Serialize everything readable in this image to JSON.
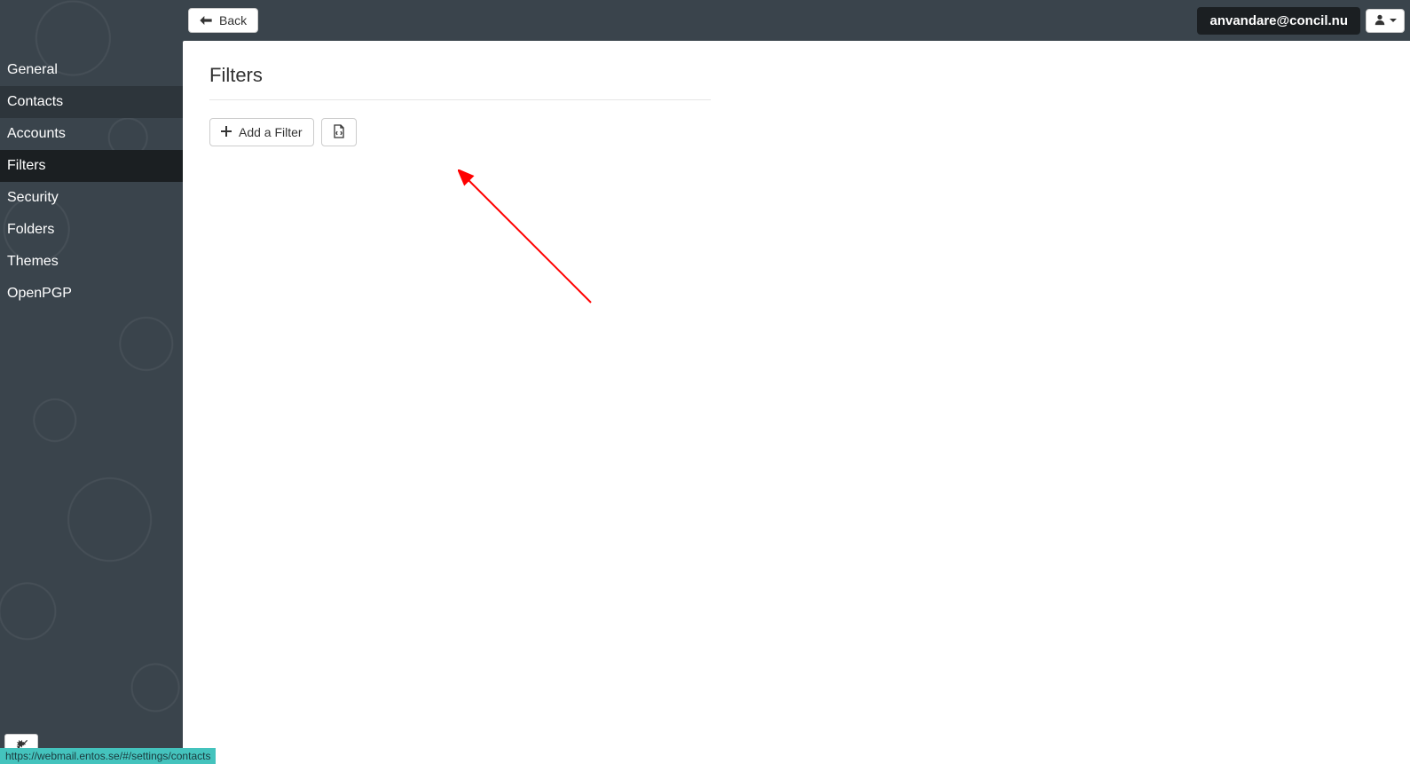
{
  "topbar": {
    "back_label": "Back",
    "user_email": "anvandare@concil.nu"
  },
  "sidebar": {
    "items": [
      {
        "label": "General",
        "active": false
      },
      {
        "label": "Contacts",
        "active": false,
        "hover": true
      },
      {
        "label": "Accounts",
        "active": false
      },
      {
        "label": "Filters",
        "active": true
      },
      {
        "label": "Security",
        "active": false
      },
      {
        "label": "Folders",
        "active": false
      },
      {
        "label": "Themes",
        "active": false
      },
      {
        "label": "OpenPGP",
        "active": false
      }
    ]
  },
  "page": {
    "title": "Filters",
    "add_filter_label": "Add a Filter"
  },
  "status_url": "https://webmail.entos.se/#/settings/contacts"
}
